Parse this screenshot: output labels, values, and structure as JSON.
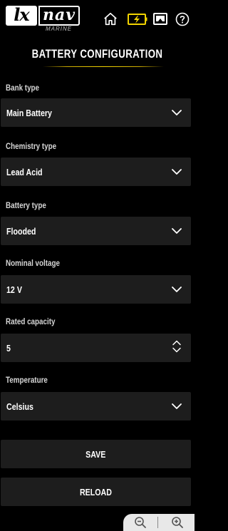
{
  "header": {
    "logo_left": "lx",
    "logo_right": "nav",
    "logo_sub": "MARINE",
    "icons": [
      "home-icon",
      "battery-charging-icon",
      "screen-icon",
      "help-icon"
    ],
    "accent_color": "#f2d400"
  },
  "page": {
    "title": "BATTERY CONFIGURATION"
  },
  "fields": [
    {
      "label": "Bank type",
      "value": "Main Battery",
      "control": "select"
    },
    {
      "label": "Chemistry type",
      "value": "Lead Acid",
      "control": "select"
    },
    {
      "label": "Battery type",
      "value": "Flooded",
      "control": "select"
    },
    {
      "label": "Nominal voltage",
      "value": "12 V",
      "control": "select"
    },
    {
      "label": "Rated capacity",
      "value": "5",
      "control": "stepper"
    },
    {
      "label": "Temperature",
      "value": "Celsius",
      "control": "select"
    }
  ],
  "actions": {
    "save": "SAVE",
    "reload": "RELOAD"
  },
  "zoom": {
    "icons": [
      "zoom-out-icon",
      "zoom-in-icon"
    ]
  }
}
